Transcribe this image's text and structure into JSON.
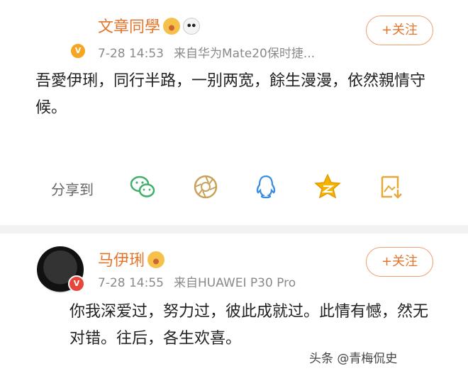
{
  "posts": [
    {
      "username": "文章同學",
      "timestamp": "7-28 14:53",
      "source": "来自华为Mate20保时捷...",
      "follow_label": "+关注",
      "verified_badge": "V",
      "text": "吾愛伊琍，同行半路，一别两宽，餘生漫漫，依然親情守候。"
    },
    {
      "username": "马伊琍",
      "timestamp": "7-28 14:55",
      "source": "来自HUAWEI P30 Pro",
      "follow_label": "+关注",
      "verified_badge": "V",
      "text": "你我深爱过，努力过，彼此成就过。此情有憾，然无对错。往后，各生欢喜。"
    }
  ],
  "share": {
    "label": "分享到",
    "icons": [
      "wechat-icon",
      "moments-icon",
      "qq-icon",
      "qzone-icon",
      "save-image-icon"
    ]
  },
  "watermark": "头条 @青梅侃史",
  "colors": {
    "accent": "#e5742b",
    "meta": "#8a8a8a",
    "wechat": "#3fb06a",
    "qzone": "#f5b300",
    "moments": "#c9a25a"
  }
}
